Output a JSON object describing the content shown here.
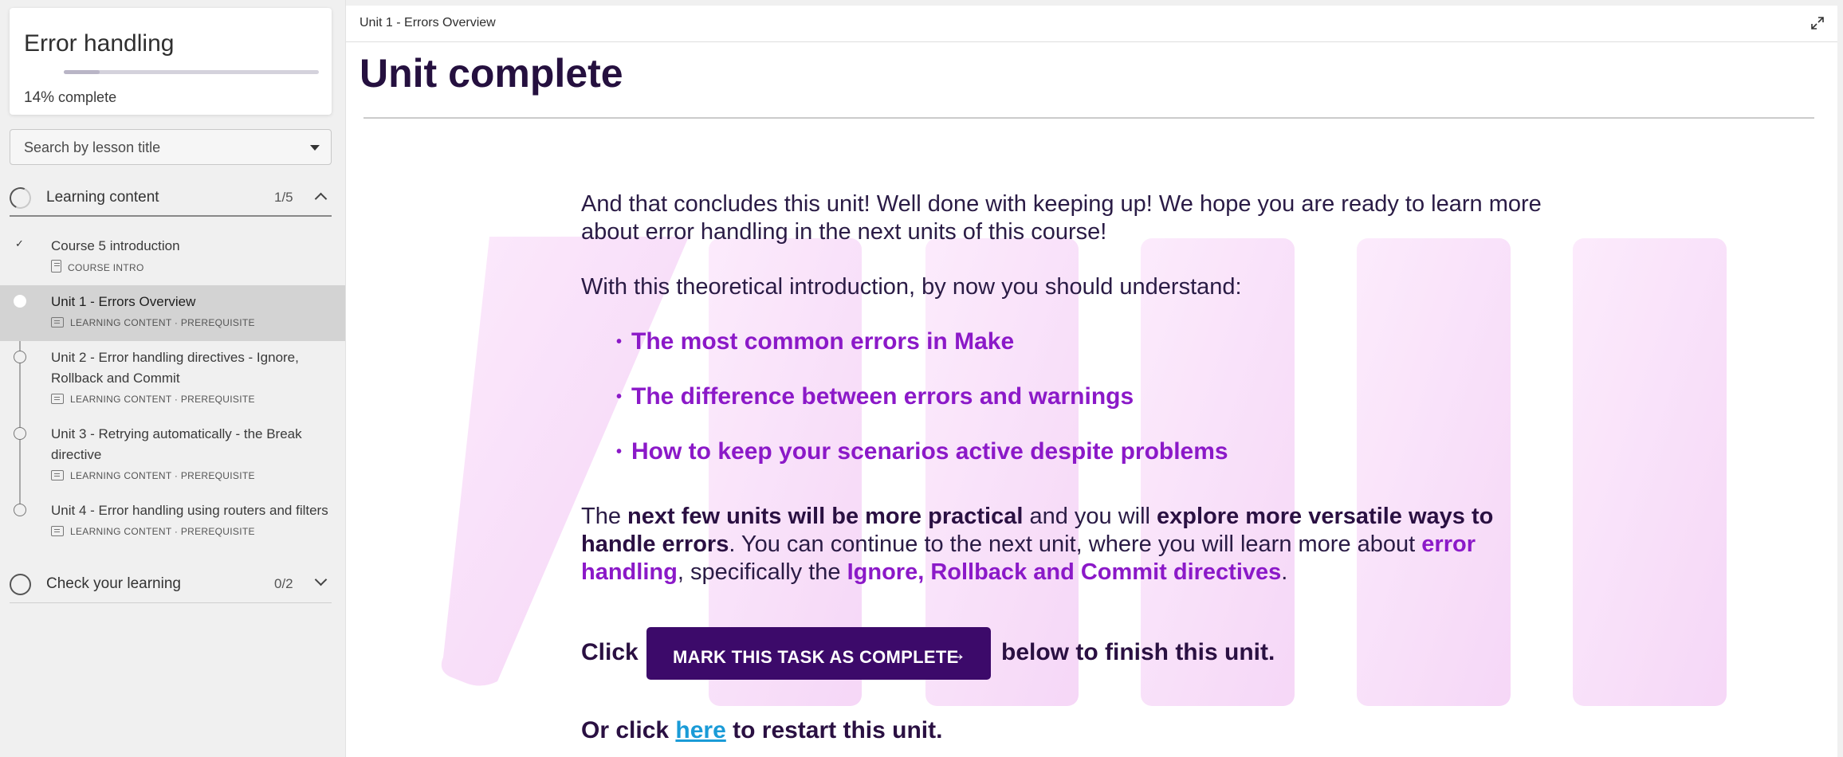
{
  "course": {
    "title": "Error handling",
    "progress_percent": 14,
    "progress_pct_text": "14%",
    "progress_suffix": "complete"
  },
  "search": {
    "placeholder": "Search by lesson title"
  },
  "sections": [
    {
      "title": "Learning content",
      "count": "1/5",
      "lessons": [
        {
          "title": "Course 5 introduction",
          "meta": "COURSE INTRO",
          "state": "completed"
        },
        {
          "title": "Unit 1 - Errors Overview",
          "meta": "LEARNING CONTENT · PREREQUISITE",
          "state": "active"
        },
        {
          "title": "Unit 2 - Error handling directives - Ignore, Rollback and Commit",
          "meta": "LEARNING CONTENT · PREREQUISITE",
          "state": "todo"
        },
        {
          "title": "Unit 3 - Retrying automatically - the Break directive",
          "meta": "LEARNING CONTENT · PREREQUISITE",
          "state": "todo"
        },
        {
          "title": "Unit 4 - Error handling using routers and filters",
          "meta": "LEARNING CONTENT · PREREQUISITE",
          "state": "todo"
        }
      ]
    },
    {
      "title": "Check your learning",
      "count": "0/2"
    }
  ],
  "main": {
    "breadcrumb": "Unit 1 - Errors Overview",
    "title": "Unit complete",
    "intro": "And that concludes this unit! Well done with keeping up! We hope you are ready to learn more about error handling in the next units of this course!",
    "theory": "With this theoretical introduction, by now you should understand:",
    "bullets": [
      "The most common errors in Make",
      "The difference between errors and warnings",
      "How to keep your scenarios active despite problems"
    ],
    "next": {
      "t1": "The ",
      "b1": "next few units will be more practical",
      "t2": " and you will ",
      "b2": "explore more versatile ways to handle errors",
      "t3": ". You can continue to the next unit, where you will learn more about ",
      "p1": "error handling",
      "t4": ", specifically the ",
      "p2": "Ignore, Rollback and Commit directives",
      "t5": "."
    },
    "click_prefix": "Click",
    "mark_button": "MARK THIS TASK AS COMPLETE",
    "click_suffix": "below to finish this unit.",
    "restart_prefix": "Or click ",
    "restart_link": "here",
    "restart_suffix": " to restart this unit."
  },
  "colors": {
    "accent_purple": "#8b19c8",
    "button_bg": "#3c0a6a",
    "title_color": "#25103f",
    "link_color": "#1a9bd7",
    "art_pink": "#f7d6f7"
  },
  "icons": [
    "check-icon",
    "course-intro-doc-icon",
    "learning-content-icon",
    "chevron-up-icon",
    "chevron-down-icon",
    "dropdown-caret-icon",
    "expand-icon",
    "arrow-right-icon"
  ]
}
